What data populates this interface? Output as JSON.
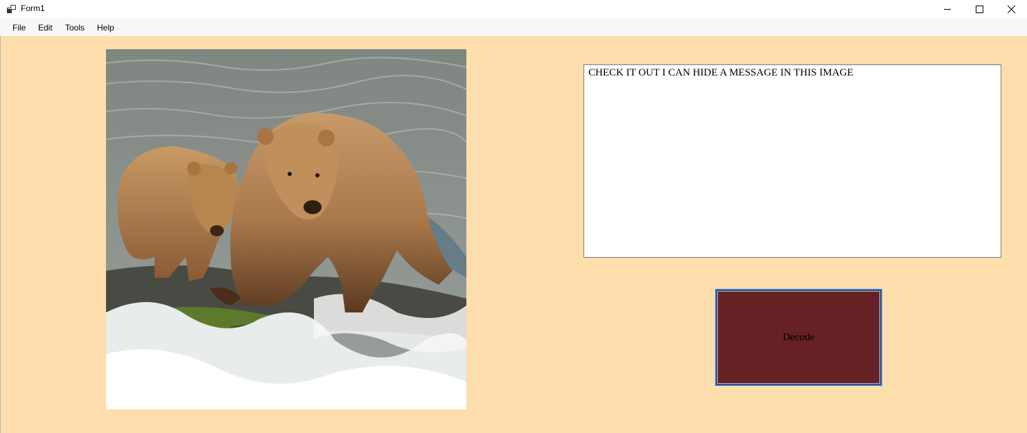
{
  "window": {
    "title": "Form1",
    "controls": [
      {
        "name": "minimize",
        "icon": "minimize-icon"
      },
      {
        "name": "maximize",
        "icon": "maximize-icon"
      },
      {
        "name": "close",
        "icon": "close-icon"
      }
    ]
  },
  "menu": {
    "file": "File",
    "edit": "Edit",
    "tools": "Tools",
    "help": "Help"
  },
  "main": {
    "picture": {
      "subject": "two brown bears standing on rocks in rushing water",
      "icon": "bear-photo"
    },
    "message_text": "CHECK IT OUT I CAN HIDE A MESSAGE IN THIS IMAGE",
    "decode_label": "Decode"
  },
  "colors": {
    "form_background": "#fddeac",
    "button_background": "#652124",
    "button_focus_border": "#2b7bd2",
    "textbox_background": "#ffffff"
  }
}
